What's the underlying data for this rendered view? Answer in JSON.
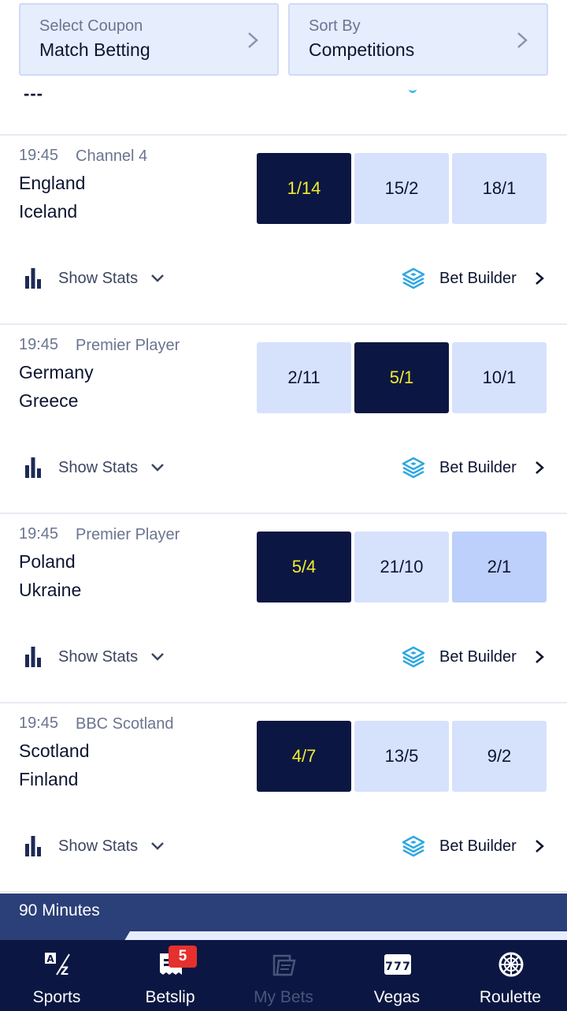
{
  "filters": {
    "coupon": {
      "label": "Select Coupon",
      "value": "Match Betting"
    },
    "sort": {
      "label": "Sort By",
      "value": "Competitions"
    }
  },
  "partial_row": {
    "dashes": "---"
  },
  "events": [
    {
      "time": "19:45",
      "channel": "Channel 4",
      "home": "England",
      "away": "Iceland",
      "odds": [
        "1/14",
        "15/2",
        "18/1"
      ],
      "selected": [
        true,
        false,
        false
      ],
      "stats_label": "Show Stats",
      "builder_label": "Bet Builder"
    },
    {
      "time": "19:45",
      "channel": "Premier Player",
      "home": "Germany",
      "away": "Greece",
      "odds": [
        "2/11",
        "5/1",
        "10/1"
      ],
      "selected": [
        false,
        true,
        false
      ],
      "stats_label": "Show Stats",
      "builder_label": "Bet Builder"
    },
    {
      "time": "19:45",
      "channel": "Premier Player",
      "home": "Poland",
      "away": "Ukraine",
      "odds": [
        "5/4",
        "21/10",
        "2/1"
      ],
      "selected": [
        true,
        false,
        false
      ],
      "stats_label": "Show Stats",
      "builder_label": "Bet Builder"
    },
    {
      "time": "19:45",
      "channel": "BBC Scotland",
      "home": "Scotland",
      "away": "Finland",
      "odds": [
        "4/7",
        "13/5",
        "9/2"
      ],
      "selected": [
        true,
        false,
        false
      ],
      "stats_label": "Show Stats",
      "builder_label": "Bet Builder"
    }
  ],
  "section": {
    "title": "90 Minutes"
  },
  "nav": {
    "items": [
      {
        "label": "Sports",
        "icon": "az-icon"
      },
      {
        "label": "Betslip",
        "icon": "betslip-icon"
      },
      {
        "label": "My Bets",
        "icon": "my-bets-icon"
      },
      {
        "label": "Vegas",
        "icon": "slots-777-icon"
      },
      {
        "label": "Roulette",
        "icon": "roulette-wheel-icon"
      }
    ],
    "betslip_count": "5"
  },
  "colors": {
    "navy": "#0b1742",
    "selected_odds_text": "#f4ec2c",
    "odds_bg": "#d6e1fc",
    "accent_cyan": "#3fb8e8",
    "badge_red": "#e6302e"
  }
}
